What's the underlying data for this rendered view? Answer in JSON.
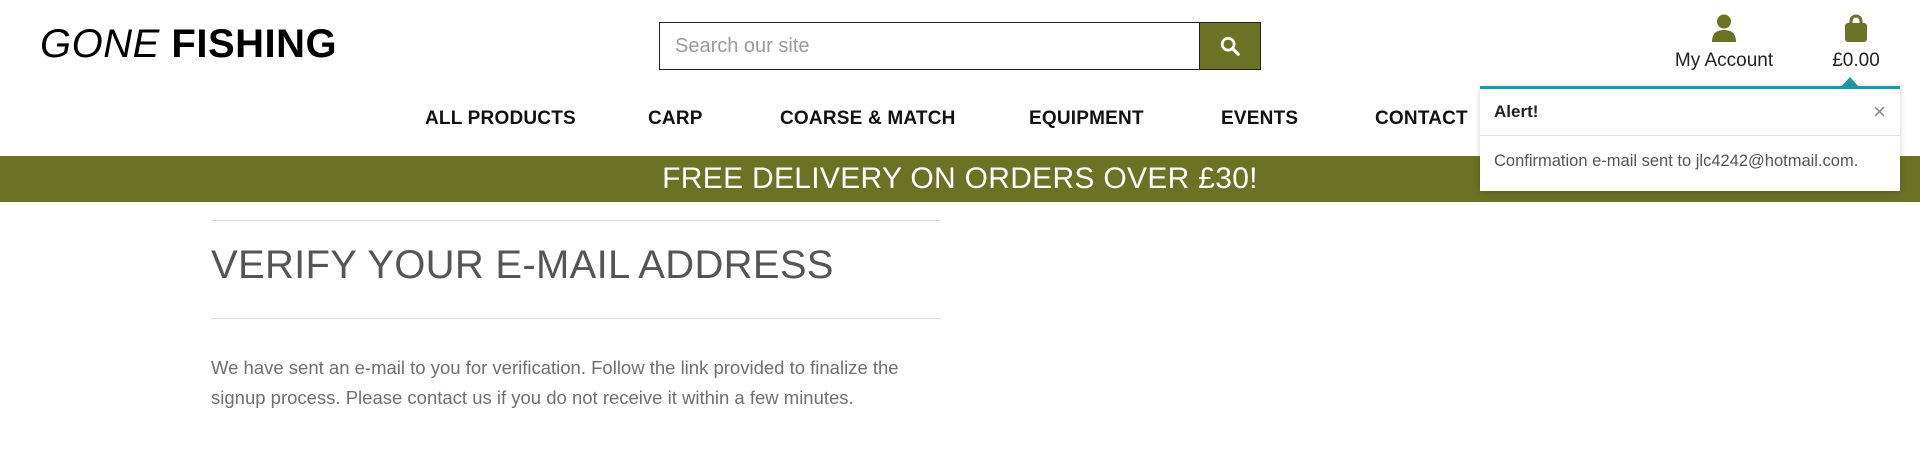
{
  "header": {
    "logo_light": "GONE",
    "logo_bold": "FISHING",
    "search_placeholder": "Search our site",
    "account_label": "My Account",
    "bag_total": "£0.00"
  },
  "nav": {
    "items": [
      "ALL PRODUCTS",
      "CARP",
      "COARSE & MATCH",
      "EQUIPMENT",
      "EVENTS",
      "CONTACT"
    ]
  },
  "banner": {
    "text": "FREE DELIVERY ON ORDERS OVER £30!"
  },
  "page": {
    "title": "VERIFY YOUR E-MAIL ADDRESS",
    "body": "We have sent an e-mail to you for verification. Follow the link provided to finalize the signup process. Please contact us if you do not receive it within a few minutes."
  },
  "alert": {
    "title": "Alert!",
    "close": "×",
    "message": "Confirmation e-mail sent to jlc4242@hotmail.com."
  },
  "colors": {
    "brand_olive": "#6b7226",
    "alert_accent": "#1a9aa8"
  },
  "icons": {
    "search": "search-icon",
    "account": "user-icon",
    "bag": "shopping-bag-icon",
    "close": "close-icon"
  }
}
